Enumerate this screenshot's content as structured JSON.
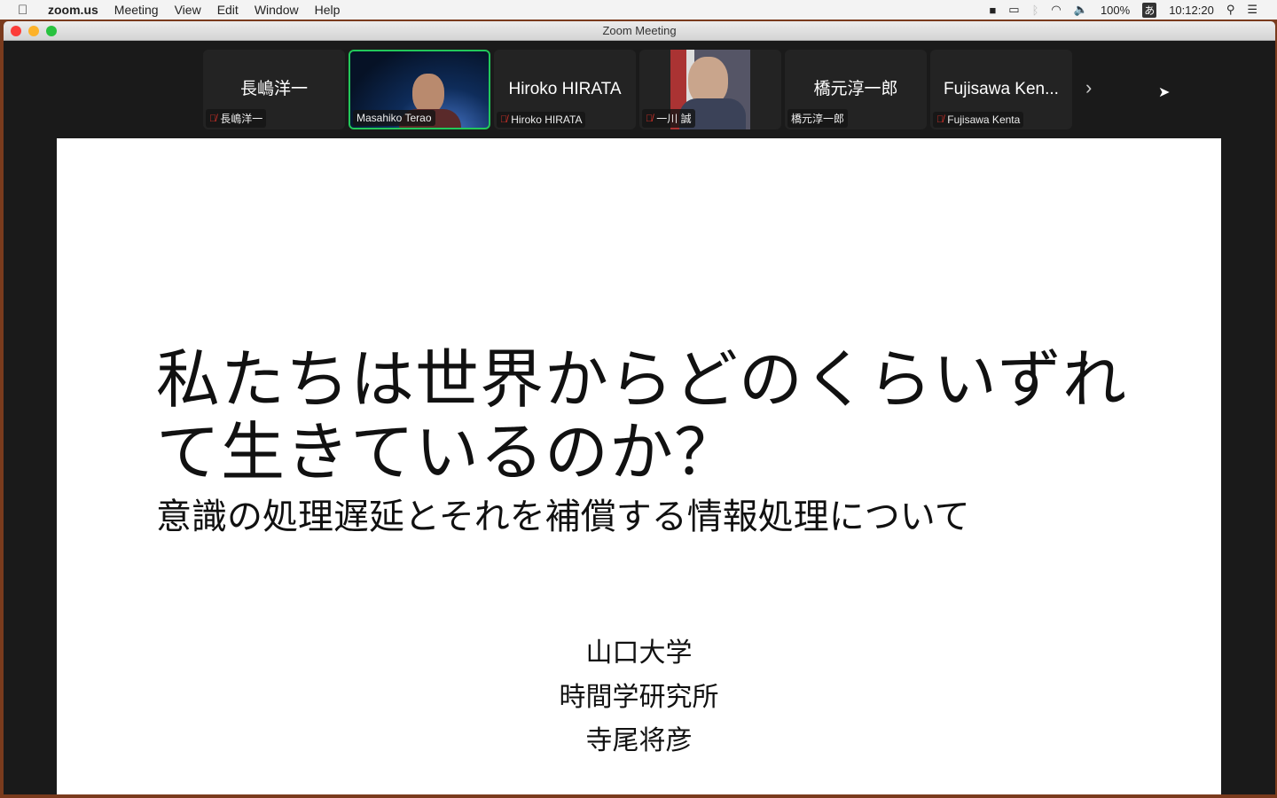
{
  "menubar": {
    "app": "zoom.us",
    "items": [
      "Meeting",
      "View",
      "Edit",
      "Window",
      "Help"
    ],
    "battery": "100%",
    "ime": "あ",
    "clock": "10:12:20"
  },
  "window": {
    "title": "Zoom Meeting"
  },
  "participants": [
    {
      "display": "長嶋洋一",
      "name": "長嶋洋一",
      "muted": true
    },
    {
      "display": "",
      "name": "Masahiko Terao",
      "muted": false,
      "active": true
    },
    {
      "display": "Hiroko HIRATA",
      "name": "Hiroko HIRATA",
      "muted": true
    },
    {
      "display": "",
      "name": "一川 誠",
      "muted": true
    },
    {
      "display": "橋元淳一郎",
      "name": "橋元淳一郎",
      "muted": false
    },
    {
      "display": "Fujisawa Ken...",
      "name": "Fujisawa Kenta",
      "muted": true
    }
  ],
  "slide": {
    "title": "私たちは世界からどのくらいずれて生きているのか？",
    "subtitle": "意識の処理遅延とそれを補償する情報処理について",
    "affiliation1": "山口大学",
    "affiliation2": "時間学研究所",
    "author": "寺尾将彦"
  },
  "colors": {
    "active_speaker": "#22c75a",
    "mute": "#e0332a"
  }
}
